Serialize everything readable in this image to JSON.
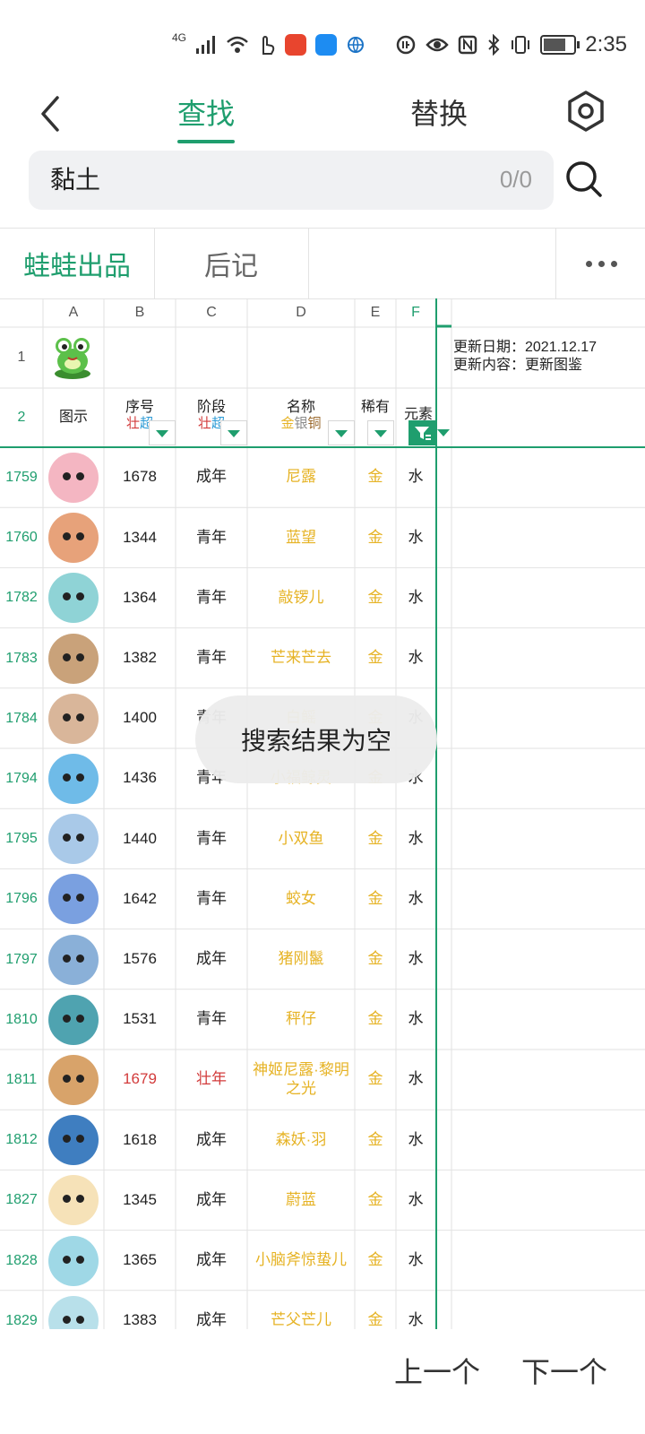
{
  "status_bar": {
    "network": "4G",
    "time": "2:35",
    "battery_level": 0.8
  },
  "header": {
    "tab_find": "查找",
    "tab_replace": "替换"
  },
  "search": {
    "value": "黏土",
    "count": "0/0"
  },
  "sheet_tabs": [
    "蛙蛙出品",
    "后记"
  ],
  "columns": [
    "A",
    "B",
    "C",
    "D",
    "E",
    "F"
  ],
  "row1": {
    "num": "1",
    "note_line1": "更新日期：2021.12.17",
    "note_line2": "更新内容：更新图鉴"
  },
  "row2": {
    "num": "2",
    "a": "图示",
    "b_title": "序号",
    "b_sub1": "壮",
    "b_sub2": "超",
    "c_title": "阶段",
    "c_sub1": "壮",
    "c_sub2": "超",
    "d_title": "名称",
    "d_sub1": "金",
    "d_sub2": "银",
    "d_sub3": "铜",
    "e_title": "稀有",
    "f_title": "元素"
  },
  "rows": [
    {
      "num": "1759",
      "b": "1678",
      "c": "成年",
      "d": "尼露",
      "e": "金",
      "f": "水"
    },
    {
      "num": "1760",
      "b": "1344",
      "c": "青年",
      "d": "蓝望",
      "e": "金",
      "f": "水"
    },
    {
      "num": "1782",
      "b": "1364",
      "c": "青年",
      "d": "敲锣儿",
      "e": "金",
      "f": "水"
    },
    {
      "num": "1783",
      "b": "1382",
      "c": "青年",
      "d": "芒来芒去",
      "e": "金",
      "f": "水"
    },
    {
      "num": "1784",
      "b": "1400",
      "c": "青年",
      "d": "白鳐",
      "e": "金",
      "f": "水"
    },
    {
      "num": "1794",
      "b": "1436",
      "c": "青年",
      "d": "小福鲸灵",
      "e": "金",
      "f": "水"
    },
    {
      "num": "1795",
      "b": "1440",
      "c": "青年",
      "d": "小双鱼",
      "e": "金",
      "f": "水"
    },
    {
      "num": "1796",
      "b": "1642",
      "c": "青年",
      "d": "蛟女",
      "e": "金",
      "f": "水"
    },
    {
      "num": "1797",
      "b": "1576",
      "c": "成年",
      "d": "猪刚鬣",
      "e": "金",
      "f": "水"
    },
    {
      "num": "1810",
      "b": "1531",
      "c": "青年",
      "d": "秤仔",
      "e": "金",
      "f": "水"
    },
    {
      "num": "1811",
      "b": "1679",
      "c": "壮年",
      "d": "神姬尼露·黎明之光",
      "e": "金",
      "f": "水"
    },
    {
      "num": "1812",
      "b": "1618",
      "c": "成年",
      "d": "森妖·羽",
      "e": "金",
      "f": "水"
    },
    {
      "num": "1827",
      "b": "1345",
      "c": "成年",
      "d": "蔚蓝",
      "e": "金",
      "f": "水"
    },
    {
      "num": "1828",
      "b": "1365",
      "c": "成年",
      "d": "小脑斧惊蛰儿",
      "e": "金",
      "f": "水"
    },
    {
      "num": "1829",
      "b": "1383",
      "c": "成年",
      "d": "芒父芒儿",
      "e": "金",
      "f": "水"
    }
  ],
  "toast": "搜索结果为空",
  "bottom": {
    "prev": "上一个",
    "next": "下一个"
  },
  "colors": {
    "accent": "#1f9e6e",
    "gold": "#e6b325",
    "red": "#d23b3b"
  }
}
